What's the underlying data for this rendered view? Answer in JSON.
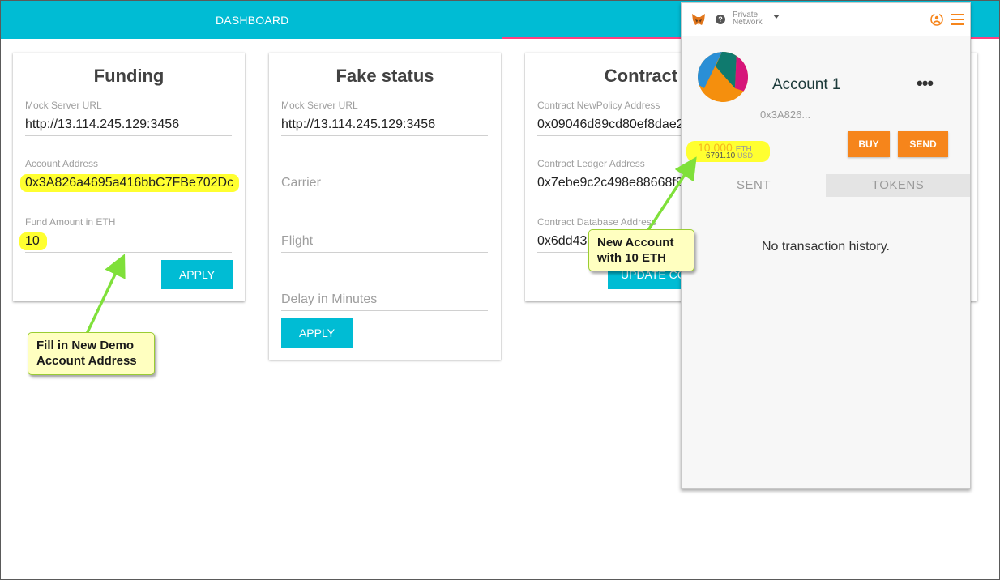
{
  "nav": {
    "dashboard_tab": "DASHBOARD"
  },
  "funding": {
    "title": "Funding",
    "mock_server_label": "Mock Server URL",
    "mock_server_value": "http://13.114.245.129:3456",
    "account_label": "Account Address",
    "account_value": "0x3A826a4695a416bbC7FBe702Dc",
    "amount_label": "Fund Amount in ETH",
    "amount_value": "10",
    "apply_label": "APPLY"
  },
  "fake_status": {
    "title": "Fake status",
    "mock_server_label": "Mock Server URL",
    "mock_server_value": "http://13.114.245.129:3456",
    "carrier_placeholder": "Carrier",
    "flight_placeholder": "Flight",
    "delay_placeholder": "Delay in Minutes",
    "apply_label": "APPLY"
  },
  "contract": {
    "title": "Contract",
    "policy_label": "Contract NewPolicy Address",
    "policy_value": "0x09046d89cd80ef8dae2",
    "ledger_label": "Contract Ledger Address",
    "ledger_value": "0x7ebe9c2c498e88668f9",
    "database_label": "Contract Database Address",
    "database_value": "0x6dd43",
    "update_label": "UPDATE CO"
  },
  "metamask": {
    "network_line1": "Private",
    "network_line2": "Network",
    "help_glyph": "?",
    "account_name": "Account 1",
    "more_glyph": "•••",
    "address": "0x3A826...",
    "balance_eth": "10.000",
    "balance_eth_unit": "ETH",
    "balance_usd": "6791.10",
    "balance_usd_unit": "USD",
    "buy_label": "BUY",
    "send_label": "SEND",
    "tabs": [
      "SENT",
      "TOKENS"
    ],
    "active_tab": "SENT",
    "empty_message": "No transaction history.",
    "icons": [
      "fox-icon",
      "help-icon",
      "network-caret-icon",
      "sync-icon",
      "menu-icon"
    ],
    "accent_color": "#f6851b"
  },
  "callouts": {
    "fill_line1": "Fill in New Demo",
    "fill_line2": "Account Address",
    "new_line1": "New Account",
    "new_line2": "with 10 ETH"
  },
  "colors": {
    "primary": "#00bcd4",
    "tab_indicator": "#ff4081",
    "highlight": "#ffff30",
    "callout_bg": "#ffffc0",
    "arrow": "#7fe03a"
  }
}
